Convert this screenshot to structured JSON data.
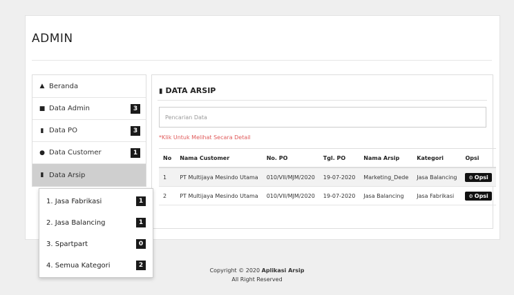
{
  "app": {
    "title": "ADMIN"
  },
  "sidebar": {
    "items": [
      {
        "label": "Beranda",
        "icon": "home-icon",
        "badge": ""
      },
      {
        "label": "Data Admin",
        "icon": "lock-icon",
        "badge": "3"
      },
      {
        "label": "Data PO",
        "icon": "book-icon",
        "badge": "3"
      },
      {
        "label": "Data Customer",
        "icon": "user-icon",
        "badge": "1"
      },
      {
        "label": "Data Arsip",
        "icon": "book-icon",
        "badge": ""
      }
    ]
  },
  "dropdown": {
    "items": [
      {
        "label": "1. Jasa Fabrikasi",
        "badge": "1"
      },
      {
        "label": "2. Jasa Balancing",
        "badge": "1"
      },
      {
        "label": "3. Spartpart",
        "badge": "0"
      },
      {
        "label": "4. Semua Kategori",
        "badge": "2"
      }
    ]
  },
  "panel": {
    "title": "DATA ARSIP",
    "search_placeholder": "Pencarian Data",
    "hint": "*Klik Untuk Melihat Secara Detail",
    "columns": [
      "No",
      "Nama Customer",
      "No. PO",
      "Tgl. PO",
      "Nama Arsip",
      "Kategori",
      "Opsi"
    ],
    "rows": [
      [
        "1",
        "PT Multijaya Mesindo Utama",
        "010/VII/MJM/2020",
        "19-07-2020",
        "Marketing_Dede",
        "Jasa Balancing"
      ],
      [
        "2",
        "PT Multijaya Mesindo Utama",
        "010/VII/MJM/2020",
        "19-07-2020",
        "Jasa Balancing",
        "Jasa Fabrikasi"
      ]
    ],
    "action_label": "Opsi"
  },
  "footer": {
    "copyright_prefix": "Copyright © 2020",
    "app_name": "Aplikasi Arsip",
    "rights": "All Right Reserved"
  },
  "colors": {
    "badge": "#1a1a1a",
    "active_item": "#cfcfcf",
    "hint": "#e05a5a",
    "button": "#111111"
  }
}
